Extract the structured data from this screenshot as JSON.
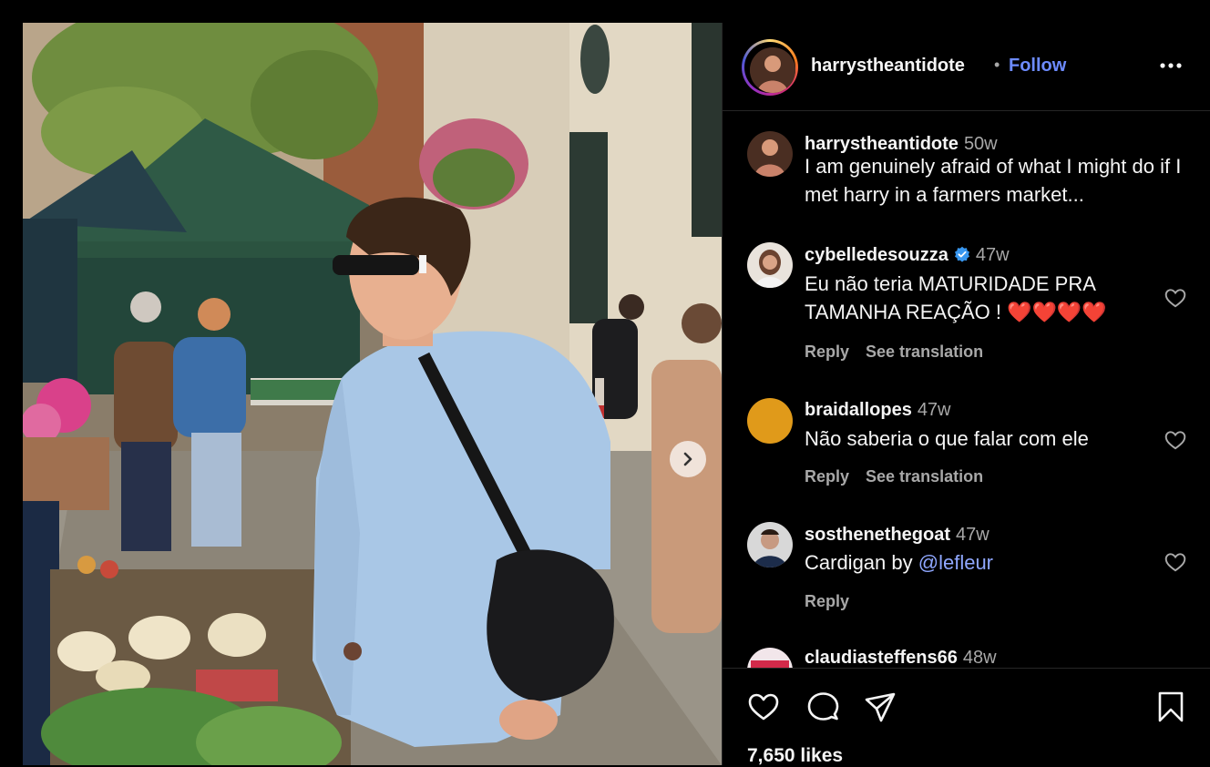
{
  "post": {
    "username": "harrystheantidote",
    "follow_label": "Follow",
    "separator": "•",
    "likes": "7,650 likes"
  },
  "caption": {
    "username": "harrystheantidote",
    "time": "50w",
    "text": "I am genuinely afraid of what I might do if I met harry in a farmers market..."
  },
  "comments": [
    {
      "username": "cybelledesouzza",
      "verified": true,
      "time": "47w",
      "text": "Eu não teria MATURIDADE PRA TAMANHA REAÇÃO ! ❤️❤️❤️❤️",
      "actions": [
        "Reply",
        "See translation"
      ]
    },
    {
      "username": "braidallopes",
      "verified": false,
      "time": "47w",
      "text": "Não saberia o que falar com ele",
      "actions": [
        "Reply",
        "See translation"
      ]
    },
    {
      "username": "sosthenethegoat",
      "verified": false,
      "time": "47w",
      "text_prefix": "Cardigan by ",
      "mention": "@lefleur",
      "actions": [
        "Reply"
      ]
    },
    {
      "username": "claudiasteffens66",
      "verified": false,
      "time": "48w"
    }
  ],
  "icons": {
    "more": "more-options-icon",
    "like": "heart-icon",
    "comment": "comment-icon",
    "share": "share-icon",
    "save": "bookmark-icon",
    "next": "chevron-right-icon",
    "verified": "verified-badge-icon"
  },
  "colors": {
    "accent": "#6d8bff",
    "mention": "#8fa7ff",
    "muted": "#a8a8a8",
    "background": "#000000",
    "verified": "#3897f0",
    "avatar_placeholder": "#e09a1a"
  }
}
